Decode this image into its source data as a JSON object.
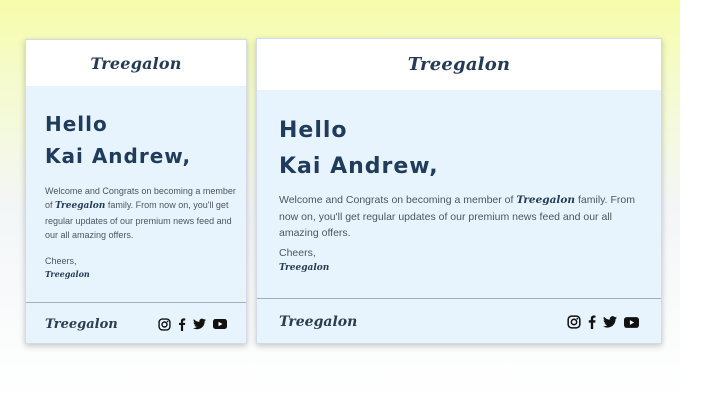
{
  "brand": "Treegalon",
  "colors": {
    "accent": "#1f3c5c",
    "card_background": "#e8f4fd"
  },
  "cards": [
    {
      "greeting": "Hello",
      "name": "Kai Andrew,",
      "message_before": "Welcome and Congrats on becoming a member of ",
      "message_after": " family. From now on, you'll get regular updates of our premium news feed and our all amazing offers.",
      "cheers": "Cheers,",
      "signature": "Treegalon",
      "social_icons": [
        "instagram-icon",
        "facebook-icon",
        "twitter-icon",
        "youtube-icon"
      ]
    },
    {
      "greeting": "Hello",
      "name": "Kai Andrew,",
      "message_before": "Welcome and Congrats on becoming a member of ",
      "message_after": " family. From now on, you'll get regular updates of our premium news feed and our all amazing offers.",
      "cheers": "Cheers,",
      "signature": "Treegalon",
      "social_icons": [
        "instagram-icon",
        "facebook-icon",
        "twitter-icon",
        "youtube-icon"
      ]
    }
  ]
}
